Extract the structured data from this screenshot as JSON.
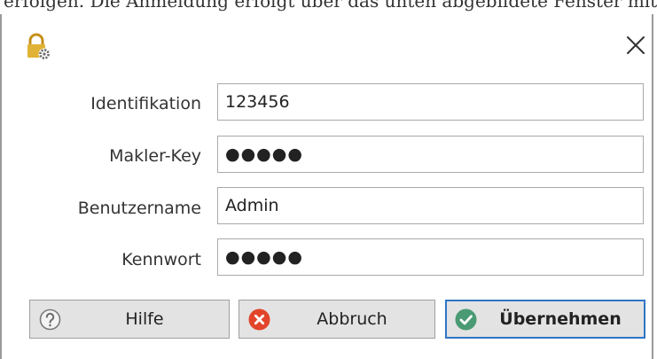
{
  "clipped_caption": "erfolgen. Die Anmeldung erfolgt über das unten abgebildete Fenster mit den entsprechenden",
  "window": {
    "icon": "lock-gear-icon",
    "close_icon": "close-icon"
  },
  "form": {
    "identifikation": {
      "label": "Identifikation",
      "value": "123456"
    },
    "makler_key": {
      "label": "Makler-Key",
      "value": "●●●●●"
    },
    "benutzername": {
      "label": "Benutzername",
      "value": "Admin"
    },
    "kennwort": {
      "label": "Kennwort",
      "value": "●●●●●"
    }
  },
  "buttons": {
    "hilfe": {
      "label": "Hilfe",
      "icon": "help-icon"
    },
    "abbruch": {
      "label": "Abbruch",
      "icon": "cancel-icon",
      "color": "#e2452a"
    },
    "uebernehmen": {
      "label": "Übernehmen",
      "icon": "check-icon",
      "color": "#4a9a73"
    }
  },
  "colors": {
    "focus_border": "#2f76c6",
    "icon_gold": "#d8a92a"
  }
}
